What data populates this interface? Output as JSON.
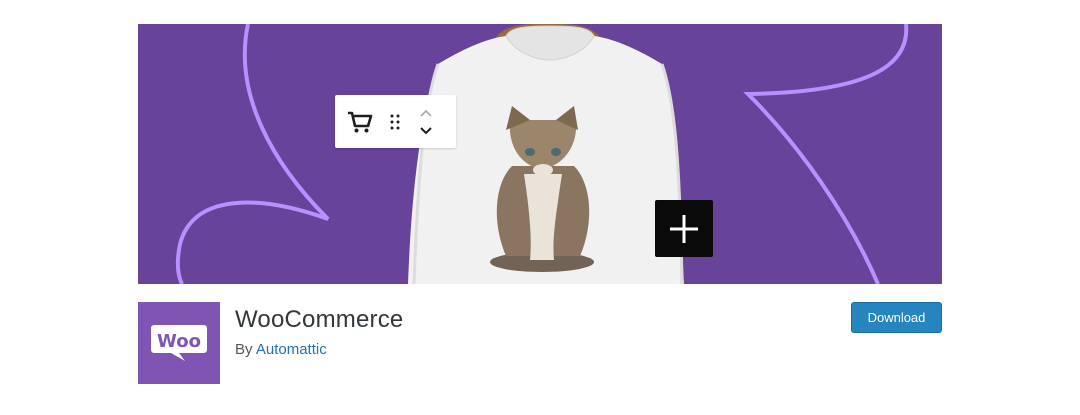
{
  "banner": {
    "background_color": "#674399",
    "accent_line_color": "#b990ff",
    "toolbar_icons": [
      "cart-icon",
      "drag-handle-icon",
      "chevron-up-icon",
      "chevron-down-icon"
    ],
    "overlay_button_icon": "plus-icon"
  },
  "plugin": {
    "logo_text": "Woo",
    "logo_color": "#7f54b3",
    "name": "WooCommerce",
    "by_label": "By",
    "author": "Automattic"
  },
  "actions": {
    "download_label": "Download",
    "download_color": "#2684be"
  }
}
